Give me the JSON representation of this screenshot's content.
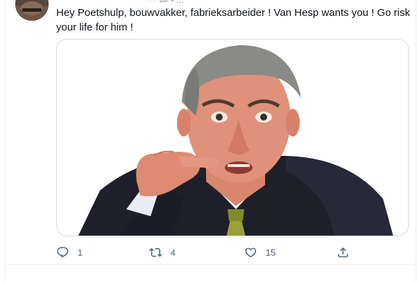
{
  "header": {
    "peek_text": "@ • ...",
    "peek_emoji": "◔◔"
  },
  "tweet": {
    "text": "Hey Poetshulp, bouwvakker, fabrieksarbeider ! Van Hesp wants you ! Go risk your life for him !",
    "replies": "1",
    "retweets": "4",
    "likes": "15"
  },
  "colors": {
    "text": "#0f1419",
    "secondary": "#536471",
    "border": "#cfd9de",
    "divider": "#ebeef0"
  },
  "icons": {
    "reply": "reply-icon",
    "retweet": "retweet-icon",
    "like": "heart-icon",
    "share": "share-icon"
  }
}
